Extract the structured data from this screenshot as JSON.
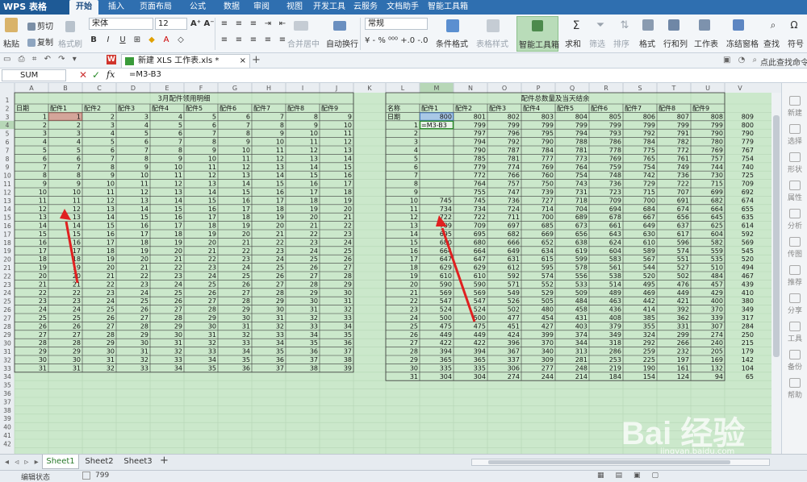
{
  "app": {
    "logo": "WPS 表格"
  },
  "menu_tabs": [
    "开始",
    "插入",
    "页面布局",
    "公式",
    "数据",
    "审阅",
    "视图",
    "开发工具",
    "云服务",
    "文档助手",
    "智能工具箱"
  ],
  "ribbon": {
    "paste": "粘贴",
    "cut": "剪切",
    "copy": "复制",
    "format_painter": "格式刷",
    "font_name": "宋体",
    "font_size": "12",
    "merge_center": "合并居中",
    "wrap_text": "自动换行",
    "number_format": "常规",
    "cond_format": "条件格式",
    "table_style": "表格样式",
    "smart_toolbox": "智能工具箱",
    "sum": "求和",
    "filter": "筛选",
    "sort": "排序",
    "format": "格式",
    "row_col": "行和列",
    "worksheet": "工作表",
    "freeze": "冻结窗格",
    "find": "查找",
    "symbol": "符号"
  },
  "quick_access": {
    "file_tab": "新建 XLS 工作表.xls *",
    "help_search": "点此查找命令"
  },
  "formula_bar": {
    "name_box": "SUM",
    "fx": "fx",
    "formula": "=M3-B3"
  },
  "columns": [
    "A",
    "B",
    "C",
    "D",
    "E",
    "F",
    "G",
    "H",
    "I",
    "J",
    "K",
    "L",
    "M",
    "N",
    "O",
    "P",
    "Q",
    "R",
    "S",
    "T",
    "U",
    "V"
  ],
  "row_numbers": [
    "1",
    "2",
    "3",
    "4",
    "5",
    "6",
    "7",
    "8",
    "9",
    "10",
    "11",
    "12",
    "13",
    "14",
    "15",
    "16",
    "17",
    "18",
    "19",
    "20",
    "21",
    "22",
    "23",
    "24",
    "25",
    "26",
    "27",
    "28",
    "29",
    "30",
    "31",
    "32",
    "33",
    "34",
    "35",
    "36",
    "37",
    "38",
    "39",
    "40",
    "41",
    "42"
  ],
  "table1": {
    "title": "3月配件领用明细",
    "headers": [
      "日期",
      "配件1",
      "配件2",
      "配件3",
      "配件4",
      "配件5",
      "配件6",
      "配件7",
      "配件8",
      "配件9"
    ]
  },
  "table2": {
    "title": "配件总数量及当天结余",
    "headers": [
      "名称",
      "配件1",
      "配件2",
      "配件3",
      "配件4",
      "配件5",
      "配件6",
      "配件7",
      "配件8",
      "配件9"
    ],
    "total_label": "日期",
    "totals": [
      800,
      801,
      802,
      803,
      804,
      805,
      806,
      807,
      808,
      809
    ],
    "editing_cell": "=M3-B3",
    "rows": [
      [
        "",
        799,
        799,
        799,
        799,
        799,
        799,
        799,
        799,
        800
      ],
      [
        "",
        797,
        796,
        795,
        794,
        793,
        792,
        791,
        790,
        790
      ],
      [
        "",
        794,
        792,
        790,
        788,
        786,
        784,
        782,
        780,
        779
      ],
      [
        "",
        790,
        787,
        784,
        781,
        778,
        775,
        772,
        769,
        767
      ],
      [
        "",
        785,
        781,
        777,
        773,
        769,
        765,
        761,
        757,
        754
      ],
      [
        "",
        779,
        774,
        769,
        764,
        759,
        754,
        749,
        744,
        740
      ],
      [
        "",
        772,
        766,
        760,
        754,
        748,
        742,
        736,
        730,
        725
      ],
      [
        "",
        764,
        757,
        750,
        743,
        736,
        729,
        722,
        715,
        709
      ],
      [
        "",
        755,
        747,
        739,
        731,
        723,
        715,
        707,
        699,
        692
      ],
      [
        745,
        745,
        736,
        727,
        718,
        709,
        700,
        691,
        682,
        674
      ],
      [
        734,
        734,
        724,
        714,
        704,
        694,
        684,
        674,
        664,
        655
      ],
      [
        722,
        722,
        711,
        700,
        689,
        678,
        667,
        656,
        645,
        635
      ],
      [
        709,
        709,
        697,
        685,
        673,
        661,
        649,
        637,
        625,
        614
      ],
      [
        695,
        695,
        682,
        669,
        656,
        643,
        630,
        617,
        604,
        592
      ],
      [
        680,
        680,
        666,
        652,
        638,
        624,
        610,
        596,
        582,
        569
      ],
      [
        664,
        664,
        649,
        634,
        619,
        604,
        589,
        574,
        559,
        545
      ],
      [
        647,
        647,
        631,
        615,
        599,
        583,
        567,
        551,
        535,
        520
      ],
      [
        629,
        629,
        612,
        595,
        578,
        561,
        544,
        527,
        510,
        494
      ],
      [
        610,
        610,
        592,
        574,
        556,
        538,
        520,
        502,
        484,
        467
      ],
      [
        590,
        590,
        571,
        552,
        533,
        514,
        495,
        476,
        457,
        439
      ],
      [
        569,
        569,
        549,
        529,
        509,
        489,
        469,
        449,
        429,
        410
      ],
      [
        547,
        547,
        526,
        505,
        484,
        463,
        442,
        421,
        400,
        380
      ],
      [
        524,
        524,
        502,
        480,
        458,
        436,
        414,
        392,
        370,
        349
      ],
      [
        500,
        500,
        477,
        454,
        431,
        408,
        385,
        362,
        339,
        317
      ],
      [
        475,
        475,
        451,
        427,
        403,
        379,
        355,
        331,
        307,
        284
      ],
      [
        449,
        449,
        424,
        399,
        374,
        349,
        324,
        299,
        274,
        250
      ],
      [
        422,
        422,
        396,
        370,
        344,
        318,
        292,
        266,
        240,
        215
      ],
      [
        394,
        394,
        367,
        340,
        313,
        286,
        259,
        232,
        205,
        179
      ],
      [
        365,
        365,
        337,
        309,
        281,
        253,
        225,
        197,
        169,
        142
      ],
      [
        335,
        335,
        306,
        277,
        248,
        219,
        190,
        161,
        132,
        104
      ],
      [
        304,
        304,
        274,
        244,
        214,
        184,
        154,
        124,
        94,
        65
      ]
    ]
  },
  "status": {
    "mode": "编辑状态",
    "value": "799"
  },
  "sheets": [
    "Sheet1",
    "Sheet2",
    "Sheet3"
  ],
  "right_panel": [
    "新建",
    "选择",
    "形状",
    "属性",
    "分析",
    "传图",
    "推荐",
    "分享",
    "工具",
    "备份",
    "帮助"
  ],
  "watermark": {
    "brand": "Bai 经验",
    "url": "jingyan.baidu.com"
  },
  "colors": {
    "tabbar": "#2f6fb0",
    "grid_bg": "#cbe8cb",
    "selected_cell": "#d4a59a",
    "accent": "#2f6fb0"
  }
}
